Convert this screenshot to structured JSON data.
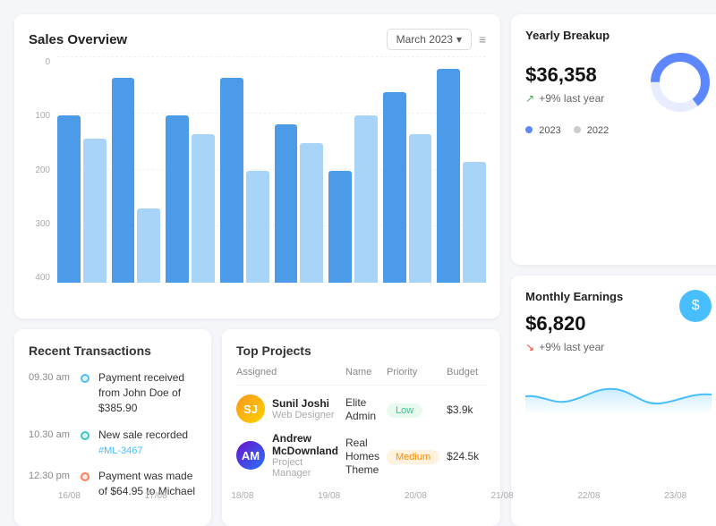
{
  "salesOverview": {
    "title": "Sales Overview",
    "dateSelectorLabel": "March 2023",
    "yAxisLabels": [
      "0",
      "100",
      "200",
      "300",
      "400"
    ],
    "xAxisLabels": [
      "16/08",
      "17/08",
      "18/08",
      "19/08",
      "20/08",
      "21/08",
      "22/08",
      "23/08"
    ],
    "bars": [
      {
        "dark": 72,
        "light": 62
      },
      {
        "dark": 88,
        "light": 32
      },
      {
        "dark": 72,
        "light": 64
      },
      {
        "dark": 88,
        "light": 48
      },
      {
        "dark": 68,
        "light": 60
      },
      {
        "dark": 48,
        "light": 72
      },
      {
        "dark": 82,
        "light": 64
      },
      {
        "dark": 92,
        "light": 52
      }
    ]
  },
  "yearlyBreakup": {
    "title": "Yearly Breakup",
    "amount": "$36,358",
    "trendPercent": "+9% last year",
    "legend": [
      {
        "label": "2023",
        "color": "#5d87ff"
      },
      {
        "label": "2022",
        "color": "#ccc"
      }
    ],
    "donut": {
      "value2023": 65,
      "value2022": 35,
      "color2023": "#5d87ff",
      "color2022": "#e8ecff"
    }
  },
  "monthlyEarnings": {
    "title": "Monthly Earnings",
    "amount": "$6,820",
    "trendPercent": "+9% last year",
    "iconLabel": "$",
    "iconBg": "#49beff"
  },
  "recentTransactions": {
    "title": "Recent Transactions",
    "items": [
      {
        "time": "09.30 am",
        "description": "Payment received from John Doe of $385.90",
        "dotType": "blue",
        "link": null
      },
      {
        "time": "10.30 am",
        "description": "New sale recorded",
        "link": "#ML-3467",
        "dotType": "teal"
      },
      {
        "time": "12.30 pm",
        "description": "Payment was made of $64.95 to Michael",
        "dotType": "coral",
        "link": null
      }
    ]
  },
  "topProjects": {
    "title": "Top Projects",
    "columns": [
      "Assigned",
      "Name",
      "Priority",
      "Budget"
    ],
    "rows": [
      {
        "name": "Sunil Joshi",
        "role": "Web Designer",
        "project": "Elite Admin",
        "priority": "Low",
        "priorityClass": "low",
        "budget": "$3.9k",
        "avatarInitials": "SJ",
        "avatarClass": "avatar-1"
      },
      {
        "name": "Andrew McDownland",
        "role": "Project Manager",
        "project": "Real Homes Theme",
        "priority": "Medium",
        "priorityClass": "medium",
        "budget": "$24.5k",
        "avatarInitials": "AM",
        "avatarClass": "avatar-2"
      }
    ]
  }
}
